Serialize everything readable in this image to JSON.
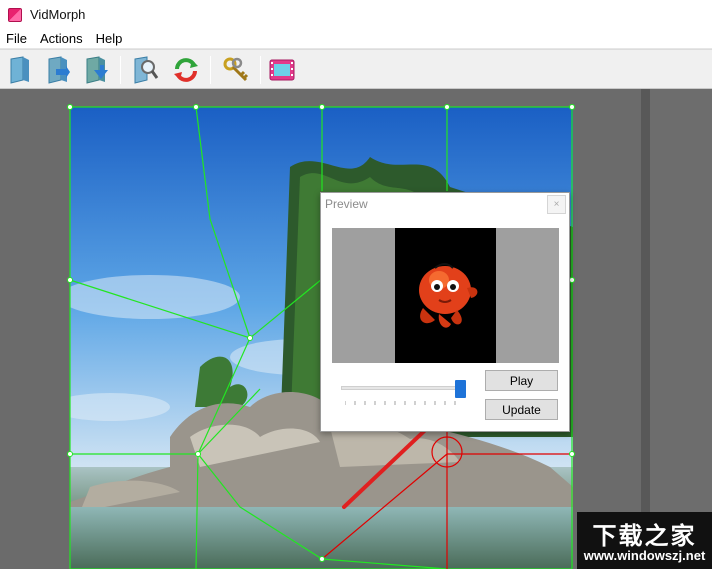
{
  "app": {
    "title": "VidMorph",
    "icon": "vidmorph-app-icon"
  },
  "menu": [
    {
      "label": "File"
    },
    {
      "label": "Actions"
    },
    {
      "label": "Help"
    }
  ],
  "toolbar": {
    "buttons": [
      {
        "name": "new-project-icon"
      },
      {
        "name": "open-project-icon"
      },
      {
        "name": "save-project-icon"
      },
      {
        "name": "find-image-icon"
      },
      {
        "name": "refresh-icon"
      },
      {
        "name": "keys-icon"
      },
      {
        "name": "preview-film-icon"
      }
    ]
  },
  "preview": {
    "title": "Preview",
    "close_label": "×",
    "play_label": "Play",
    "update_label": "Update",
    "slider_value": 0.96
  },
  "colors": {
    "mesh_line": "#22e622",
    "selected_line": "#e00000",
    "arrow": "#e02020",
    "slider_thumb": "#1e73d8"
  },
  "watermark": {
    "title": "下载之家",
    "url": "www.windowszj.net"
  }
}
